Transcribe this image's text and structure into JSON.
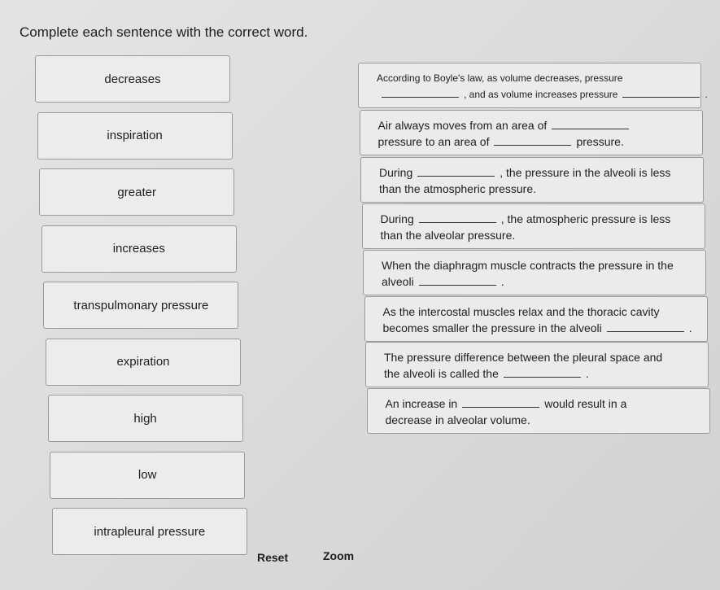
{
  "title": "Complete each sentence with the correct word.",
  "words": [
    "decreases",
    "inspiration",
    "greater",
    "increases",
    "transpulmonary pressure",
    "expiration",
    "high",
    "low",
    "intrapleural pressure"
  ],
  "sentences": [
    {
      "lines": [
        [
          "According to Boyle's law, as volume decreases, pressure"
        ],
        [
          "",
          ", and as volume increases pressure",
          "",
          "."
        ]
      ]
    },
    {
      "lines": [
        [
          "Air always moves from an area of",
          ""
        ],
        [
          "pressure to an area of",
          "",
          "pressure."
        ]
      ]
    },
    {
      "lines": [
        [
          "During",
          "",
          ", the pressure in the alveoli is less"
        ],
        [
          "than the atmospheric pressure."
        ]
      ]
    },
    {
      "lines": [
        [
          "During",
          "",
          ", the atmospheric pressure is less"
        ],
        [
          "than the alveolar pressure."
        ]
      ]
    },
    {
      "lines": [
        [
          "When the diaphragm muscle contracts the pressure in the"
        ],
        [
          "alveoli",
          "",
          "."
        ]
      ]
    },
    {
      "lines": [
        [
          "As the intercostal muscles relax and the thoracic cavity"
        ],
        [
          "becomes smaller the pressure in the alveoli",
          "",
          "."
        ]
      ]
    },
    {
      "lines": [
        [
          "The pressure difference between the pleural space and"
        ],
        [
          "the alveoli is called the",
          "",
          "."
        ]
      ]
    },
    {
      "lines": [
        [
          "An increase in",
          "",
          "would result in a"
        ],
        [
          "decrease in alveolar volume."
        ]
      ]
    }
  ],
  "buttons": {
    "reset": "Reset",
    "zoom": "Zoom"
  }
}
